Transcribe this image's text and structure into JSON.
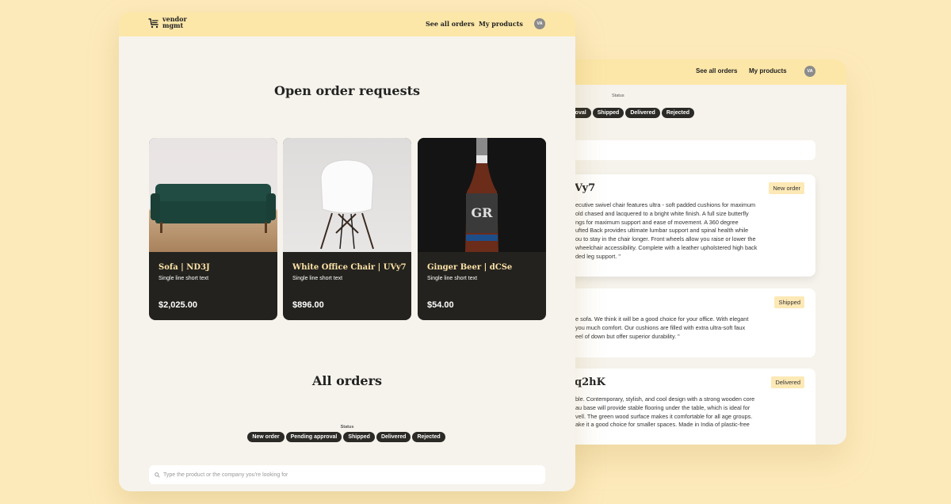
{
  "back_window": {
    "nav": {
      "see_all_orders": "See all orders",
      "my_products": "My products",
      "avatar": "VA"
    },
    "status_label": "Status",
    "filters": [
      "ng approval",
      "Shipped",
      "Delivered",
      "Rejected"
    ],
    "orders": [
      {
        "title": "Vy7",
        "badge": "New order",
        "lines": [
          "ecutive swivel chair features ultra - soft padded cushions for maximum",
          "old chased and lacquered to a bright white finish. A full size butterfly",
          "ngs for maximum support and ease of movement. A 360 degree",
          "ufted Back provides ultimate lumbar support and spinal health while",
          "ou to stay in the chair longer. Front wheels allow you raise or lower the",
          "wheelchair accessibility. Complete with a leather upholstered high back",
          "ded leg support. \""
        ]
      },
      {
        "title": "",
        "badge": "Shipped",
        "lines": [
          "e sofa. We think it will be a good choice for your office. With elegant",
          "you much comfort. Our cushions are filled with extra ultra-soft faux",
          "eel of down but offer superior durability. \""
        ]
      },
      {
        "title": "q2hK",
        "badge": "Delivered",
        "lines": [
          "ble. Contemporary, stylish, and cool design with a strong wooden core",
          "au base will provide stable flooring under the table, which is ideal for",
          "vell. The green wood surface makes it comfortable for all age groups.",
          "ake it a good choice for smaller spaces. Made in India of plastic-free"
        ]
      }
    ]
  },
  "front_window": {
    "logo": {
      "line1": "vendor",
      "line2": "mgmt"
    },
    "nav": {
      "see_all_orders": "See all orders",
      "my_products": "My products",
      "avatar": "VA"
    },
    "open_orders_title": "Open order requests",
    "products": [
      {
        "name": "Sofa | ND3J",
        "desc": "Single line short text",
        "price": "$2,025.00",
        "icon": "sofa-image"
      },
      {
        "name": "White Office Chair | UVy7",
        "desc": "Single line short text",
        "price": "$896.00",
        "icon": "chair-image"
      },
      {
        "name": "Ginger Beer | dCSe",
        "desc": "Single line short text",
        "price": "$54.00",
        "icon": "bottle-image"
      }
    ],
    "all_orders_title": "All orders",
    "status_label": "Status",
    "filters": [
      "New order",
      "Pending approval",
      "Shipped",
      "Delivered",
      "Rejected"
    ],
    "search_placeholder": "Type the product or the company you're looking for"
  },
  "colors": {
    "background": "#fdeabb",
    "header": "#fce7a9",
    "panel": "#f6f3ec",
    "card_dark": "#23221e",
    "accent_text": "#fde3a7"
  }
}
